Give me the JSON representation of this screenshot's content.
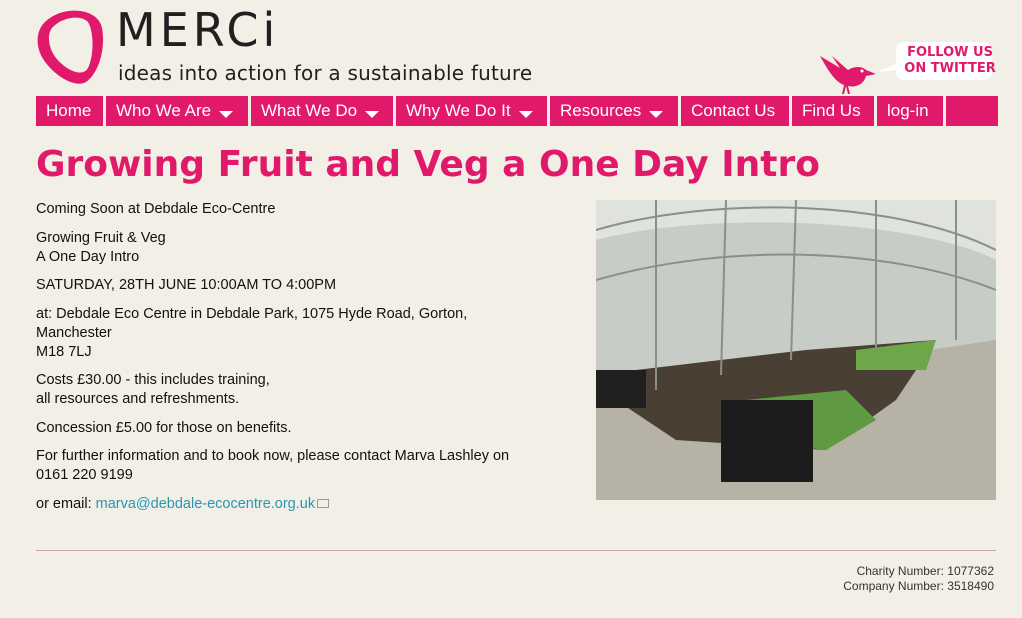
{
  "brand": {
    "name": "MERCi",
    "tagline": "ideas into action for a sustainable future",
    "accent_color": "#e0196b"
  },
  "twitter": {
    "line1": "FOLLOW US",
    "line2": "ON TWITTER"
  },
  "nav": {
    "items": [
      {
        "label": "Home",
        "has_dropdown": false
      },
      {
        "label": "Who We Are",
        "has_dropdown": true
      },
      {
        "label": "What We Do",
        "has_dropdown": true
      },
      {
        "label": "Why We Do It",
        "has_dropdown": true
      },
      {
        "label": "Resources",
        "has_dropdown": true
      },
      {
        "label": "Contact Us",
        "has_dropdown": false
      },
      {
        "label": "Find Us",
        "has_dropdown": false
      },
      {
        "label": "log-in",
        "has_dropdown": false
      },
      {
        "label": "",
        "has_dropdown": false
      }
    ]
  },
  "article": {
    "title": "Growing Fruit and Veg a One Day Intro",
    "coming_soon": "Coming Soon at Debdale Eco-Centre",
    "heading_line1": "Growing Fruit & Veg",
    "heading_line2": "A One Day Intro",
    "date_time": "SATURDAY, 28TH JUNE 10:00AM TO 4:00PM",
    "venue_line1": "at: Debdale Eco Centre in Debdale Park, 1075 Hyde Road, Gorton, Manchester",
    "venue_line2": "M18 7LJ",
    "cost_line1": "Costs £30.00 - this includes training,",
    "cost_line2": "all resources and refreshments.",
    "concession": "Concession £5.00 for those on benefits.",
    "info_line1": "For further information and to book now, please contact Marva Lashley on",
    "info_line2": "0161 220 9199",
    "email_prefix": "or email: ",
    "email": "marva@debdale-ecocentre.org.uk",
    "image_icon": "greenhouse-photo"
  },
  "footer": {
    "charity": "Charity Number: 1077362",
    "company": "Company Number: 3518490"
  }
}
